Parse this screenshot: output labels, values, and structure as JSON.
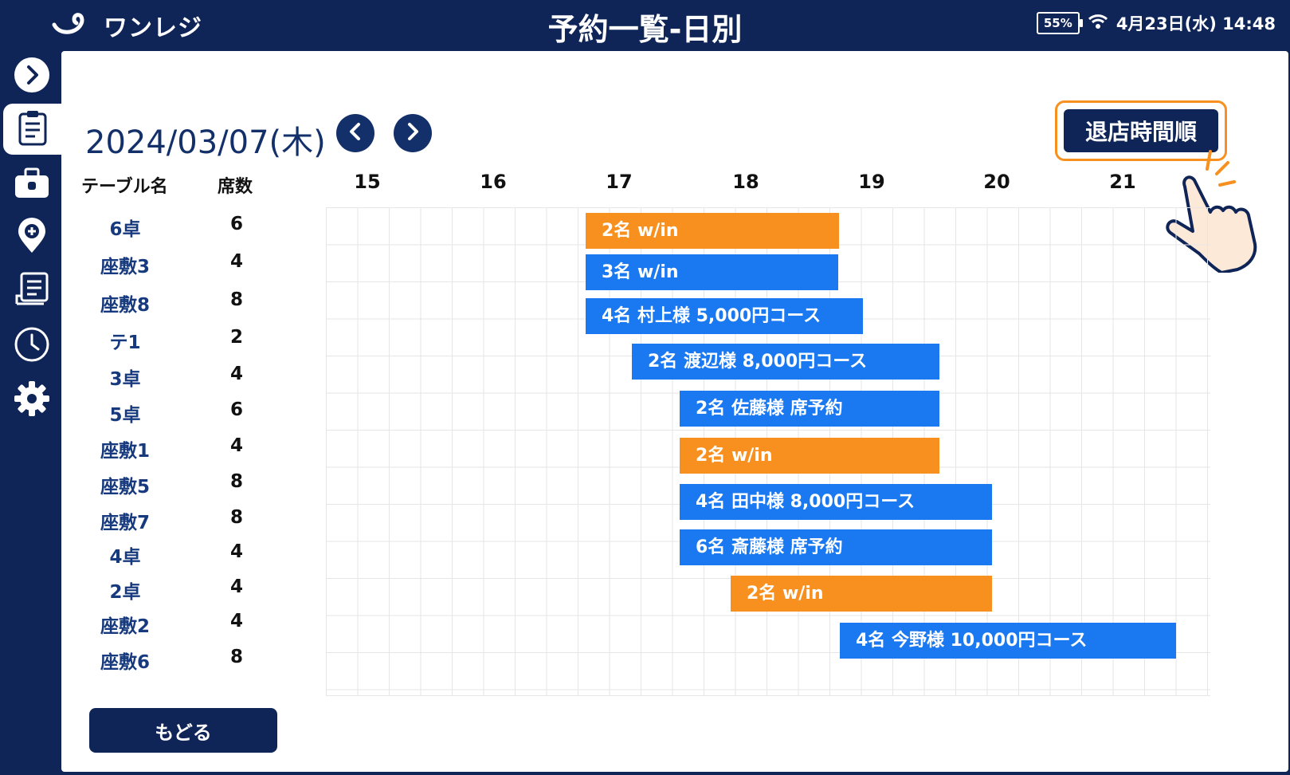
{
  "header": {
    "brand": "ワンレジ",
    "title": "予約一覧-日別",
    "battery": "55%",
    "datetime": "4月23日(水) 14:48"
  },
  "date_nav": {
    "date": "2024/03/07(木)"
  },
  "sort_button": "退店時間順",
  "table_headers": {
    "name": "テーブル名",
    "seats": "席数"
  },
  "tables": [
    {
      "name": "6卓",
      "seats": "6"
    },
    {
      "name": "座敷3",
      "seats": "4"
    },
    {
      "name": "座敷8",
      "seats": "8"
    },
    {
      "name": "テ1",
      "seats": "2"
    },
    {
      "name": "3卓",
      "seats": "4"
    },
    {
      "name": "5卓",
      "seats": "6"
    },
    {
      "name": "座敷1",
      "seats": "4"
    },
    {
      "name": "座敷5",
      "seats": "8"
    },
    {
      "name": "座敷7",
      "seats": "8"
    },
    {
      "name": "4卓",
      "seats": "4"
    },
    {
      "name": "2卓",
      "seats": "4"
    },
    {
      "name": "座敷2",
      "seats": "4"
    },
    {
      "name": "座敷6",
      "seats": "8"
    }
  ],
  "hours": [
    "15",
    "16",
    "17",
    "18",
    "19",
    "20",
    "21"
  ],
  "reservations": [
    {
      "label": "2名 w/in",
      "type": "walkin"
    },
    {
      "label": "3名 w/in",
      "type": "resv"
    },
    {
      "label": "4名 村上様 5,000円コース",
      "type": "resv"
    },
    {
      "label": "2名 渡辺様 8,000円コース",
      "type": "resv"
    },
    {
      "label": "2名 佐藤様 席予約",
      "type": "resv"
    },
    {
      "label": "2名 w/in",
      "type": "walkin"
    },
    {
      "label": "4名 田中様 8,000円コース",
      "type": "resv"
    },
    {
      "label": "6名 斎藤様 席予約",
      "type": "resv"
    },
    {
      "label": "2名 w/in",
      "type": "walkin"
    },
    {
      "label": "4名 今野様 10,000円コース",
      "type": "resv"
    }
  ],
  "back_button": "もどる",
  "colors": {
    "navy": "#0f2557",
    "walkin": "#f7901e",
    "reservation": "#1a78f0"
  },
  "sidebar_icons": [
    "chevron-right-icon",
    "clipboard-icon",
    "register-icon",
    "map-pin-icon",
    "receipt-icon",
    "clock-icon",
    "gear-icon"
  ]
}
